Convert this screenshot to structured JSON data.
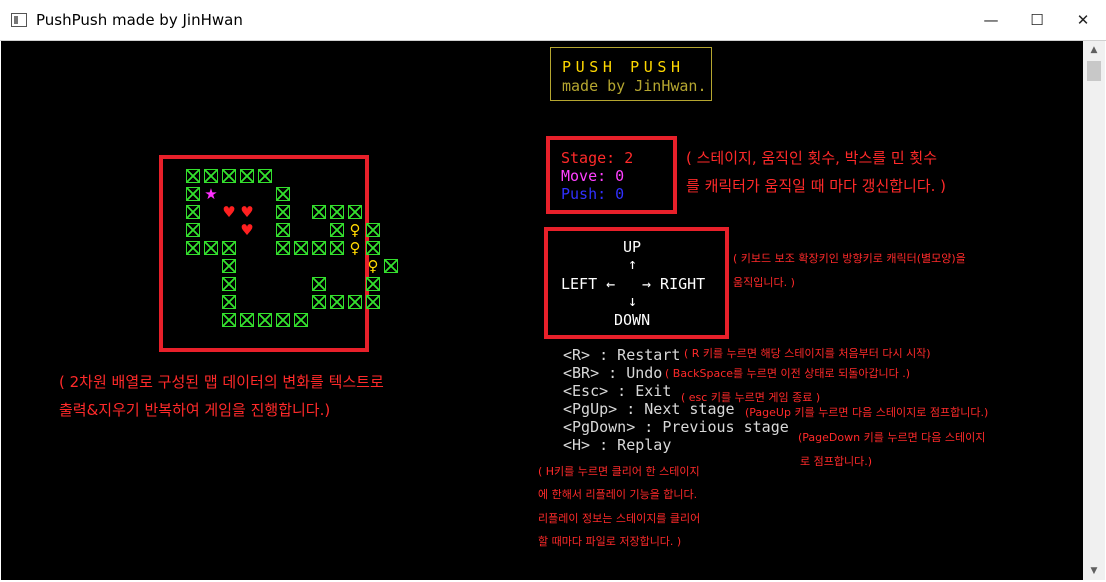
{
  "window": {
    "title": "PushPush made by JinHwan"
  },
  "controls": {
    "minimize": "—",
    "maximize": "☐",
    "close": "✕"
  },
  "logo": {
    "title": "PUSH PUSH",
    "subtitle": "made by JinHwan."
  },
  "stats": {
    "stage": "Stage: 2",
    "move": "Move: 0",
    "push": "Push: 0"
  },
  "colors": {
    "stage": "#ff2a2a",
    "move": "#ff40ff",
    "push": "#3030ff",
    "wall": "#34e02e",
    "heart": "#ff2020",
    "target": "#ffd800",
    "player": "#ff30ff"
  },
  "direction": {
    "up": "UP",
    "up_arrow": "↑",
    "left": "LEFT ←",
    "right": "→ RIGHT",
    "down_arrow": "↓",
    "down": "DOWN"
  },
  "keys": [
    "<R> : Restart",
    "<BR> : Undo",
    "<Esc> : Exit",
    "<PgUp> : Next stage",
    "<PgDown> : Previous stage",
    "<H> : Replay"
  ],
  "annotations": {
    "stats_line1": "( 스테이지, 움직인 횟수, 박스를 민 횟수",
    "stats_line2": "를 캐릭터가 움직일 때 마다 갱신합니다. )",
    "dir_line1": "( 키보드 보조 확장키인 방향키로 캐릭터(별모양)을",
    "dir_line2": "움직입니다. )",
    "restart": "( R 키를 누르면 해당 스테이지를 처음부터 다시 시작)",
    "undo": "( BackSpace를 누르면 이전 상태로 되돌아갑니다 .)",
    "exit": "( esc 키를 누르면 게임 종료 )",
    "pgup": "(PageUp 키를 누르면 다음 스테이지로 점프합니다.)",
    "pgdown1": "(PageDown 키를 누르면 다음 스테이지",
    "pgdown2": "로 점프합니다.)",
    "replay1": "( H키를 누르면 클리어 한 스테이지",
    "replay2": "에 한해서 리플레이 기능을 합니다.",
    "replay3": "리플레이 정보는 스테이지를 클리어",
    "replay4": "할 때마다 파일로 저장합니다. )",
    "map1": "( 2차원 배열로 구성된 맵 데이터의 변화를 텍스트로",
    "map2": "출력&지우기 반복하여 게임을 진행합니다.)"
  },
  "map": {
    "rows": [
      "#####.........",
      "#P...#........",
      "#.BB.#.###....",
      "#..B.#..#T#...",
      "###..####T#...",
      "..#.......T#..",
      "..#....#..#...",
      "..#....####...",
      "..#####......."
    ],
    "player_glyph": "★",
    "box_glyph": "♥",
    "target_glyph": "♀"
  }
}
